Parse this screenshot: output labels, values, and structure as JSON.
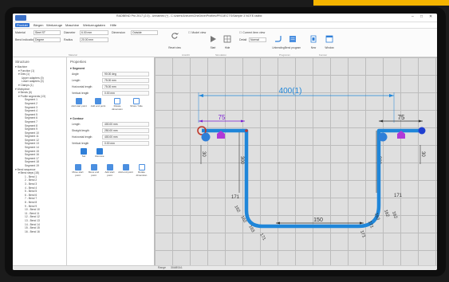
{
  "window": {
    "title": "RADBEND Pro 2017 (2.0) - Unnamed (*) - C:\\Users\\Aneurin\\OneDrive\\Profiles\\PROJECTS\\Sample 3 NOTE.radbd",
    "controls": [
      "–",
      "□",
      "✕"
    ]
  },
  "menu": {
    "items": [
      "Produkt",
      "Biegen",
      "Werkzeuge",
      "Maschine",
      "Werkzeugdaten",
      "Hilfe"
    ],
    "active_index": 0
  },
  "ribbon": {
    "material_label": "Material",
    "material_value": "Steel ST",
    "diameter_label": "Diameter",
    "diameter_value": "6.00 mm",
    "dimension_label": "Dimension",
    "dimension_value": "Outside",
    "radius_label": "Radius",
    "radius_value": "20.00 mm",
    "indication_label": "Bend indication",
    "indication_value": "Degree",
    "tools": [
      {
        "label": "Reset view",
        "icon": "reset-view-icon"
      },
      {
        "label": "Start",
        "icon": "play-icon"
      },
      {
        "label": "Hide",
        "icon": "grid-icon"
      },
      {
        "label": "Unbending",
        "icon": "unbend-icon"
      },
      {
        "label": "Bend program",
        "icon": "program-icon"
      },
      {
        "label": "New",
        "icon": "new-icon"
      },
      {
        "label": "Window",
        "icon": "window-icon"
      }
    ],
    "check_model": "Model view",
    "check_current": "Current item view",
    "check_detail": "Detail",
    "detail_mode": "Normal",
    "group_labels": [
      "Material",
      "Ansicht",
      "Simulation",
      "Programm",
      "Fenster"
    ]
  },
  "structure": {
    "title": "Structure",
    "items": [
      "Machine",
      "Function (1)",
      "Dies (1)",
      "Upper adapters (0)",
      "Lower adapters (0)",
      "Clamps (1)",
      "Workpiece",
      "Bends (6)",
      "Profile segments (13)",
      "Segment 1",
      "Segment 2",
      "Segment 3",
      "Segment 4",
      "Segment 5",
      "Segment 6",
      "Segment 7",
      "Segment 8",
      "Segment 9",
      "Segment 10",
      "Segment 11",
      "Segment 12",
      "Segment 13",
      "Segment 14",
      "Segment 15",
      "Segment 16",
      "Segment 17",
      "Segment 18",
      "Segment 19",
      "Bend sequence",
      "Bend steps (18)",
      "1 - Bend 1",
      "2 - Bend 2",
      "3 - Bend 3",
      "4 - Bend 4",
      "5 - Bend 5",
      "6 - Bend 6",
      "7 - Bend 7",
      "8 - Bend 8",
      "9 - Bend 9",
      "10 - Bend 10",
      "11 - Bend 11",
      "12 - Bend 12",
      "13 - Bend 13",
      "14 - Bend 14",
      "15 - Bend 15",
      "16 - Bend 16"
    ]
  },
  "properties": {
    "title": "Properties",
    "segment_title": "Segment",
    "segment_rows": [
      {
        "label": "Angle",
        "value": "90.00 deg"
      },
      {
        "label": "Length",
        "value": "75.00 mm"
      },
      {
        "label": "Horizontal length",
        "value": "75.00 mm"
      },
      {
        "label": "Vertical length",
        "value": "0.00 mm"
      }
    ],
    "segment_buttons": [
      "Add start point",
      "Add end point",
      "Rotate dimension",
      "Show / hide"
    ],
    "contour_title": "Contour",
    "contour_rows": [
      {
        "label": "Length",
        "value": "400.00 mm"
      },
      {
        "label": "Straight length",
        "value": "250.00 mm"
      },
      {
        "label": "Horizontal length",
        "value": "400.00 mm"
      },
      {
        "label": "Vertical length",
        "value": "0.00 mm"
      }
    ],
    "mid_buttons": [
      "Set",
      "Remove"
    ],
    "contour_buttons": [
      "Move start point",
      "Move end point",
      "Add start point",
      "Add end point",
      "Rotate dimension"
    ]
  },
  "drawing": {
    "overall_dim": "400(1)",
    "top_left_dim": "75",
    "top_right_dim": "75",
    "bottom_dim": "150",
    "left_vertical": "300",
    "right_vertical": "300",
    "left_short": "30",
    "right_short": "30",
    "left_radius": "171",
    "right_radius": "171",
    "left_arc_labels": [
      "162",
      "162",
      "163",
      "171"
    ],
    "right_arc_labels": [
      "162",
      "162",
      "163",
      "171",
      "171"
    ],
    "colors": {
      "tube": "#1f86d9",
      "dimension": "#333333",
      "overall_dimension": "#1f86d9",
      "top_dimension": "#7a1fd1",
      "start_point": "#c0392b",
      "marker": "#2f7fd8",
      "tool": "#b03ad8"
    }
  },
  "status": {
    "text": "Range",
    "value": "30ABSA1"
  },
  "accent_color": "#f5b400"
}
